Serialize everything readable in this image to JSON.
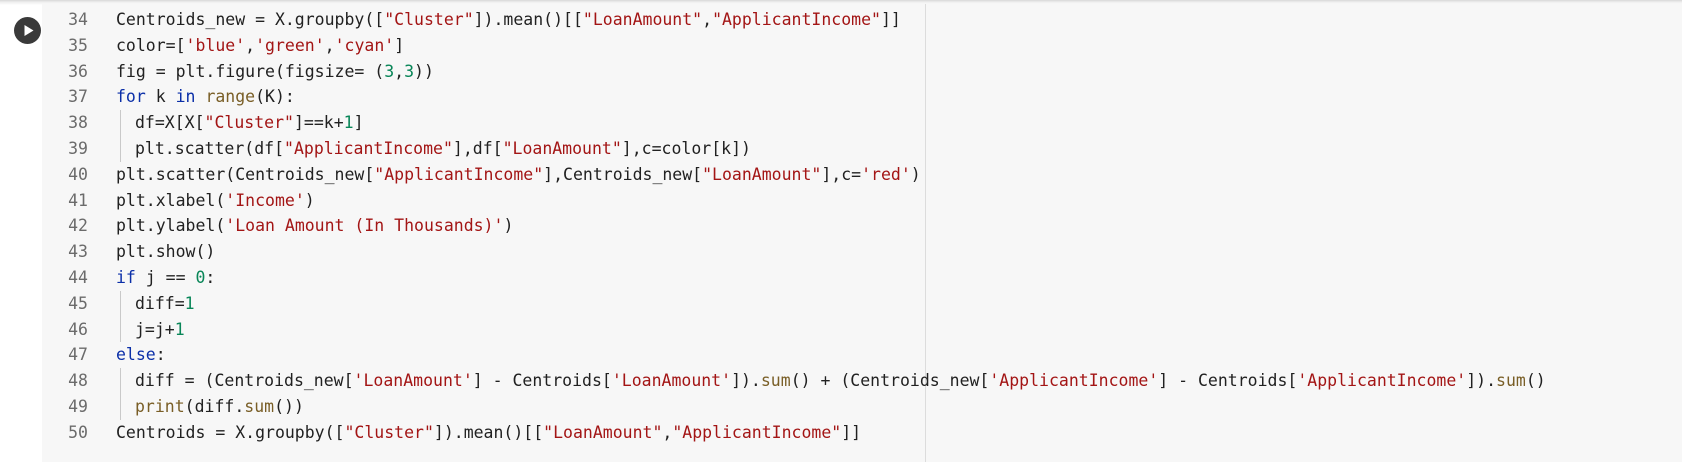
{
  "editor": {
    "lines": [
      {
        "number": "34",
        "indent": 0,
        "tokens": [
          {
            "t": "Centroids_new = X.groupby([",
            "c": "plain"
          },
          {
            "t": "\"Cluster\"",
            "c": "str"
          },
          {
            "t": "]).mean()[[",
            "c": "plain"
          },
          {
            "t": "\"LoanAmount\"",
            "c": "str"
          },
          {
            "t": ",",
            "c": "plain"
          },
          {
            "t": "\"ApplicantIncome\"",
            "c": "str"
          },
          {
            "t": "]]",
            "c": "plain"
          }
        ]
      },
      {
        "number": "35",
        "indent": 0,
        "tokens": [
          {
            "t": "color=[",
            "c": "plain"
          },
          {
            "t": "'blue'",
            "c": "str"
          },
          {
            "t": ",",
            "c": "plain"
          },
          {
            "t": "'green'",
            "c": "str"
          },
          {
            "t": ",",
            "c": "plain"
          },
          {
            "t": "'cyan'",
            "c": "str"
          },
          {
            "t": "]",
            "c": "plain"
          }
        ]
      },
      {
        "number": "36",
        "indent": 0,
        "tokens": [
          {
            "t": "fig = plt.figure(figsize= (",
            "c": "plain"
          },
          {
            "t": "3",
            "c": "num"
          },
          {
            "t": ",",
            "c": "plain"
          },
          {
            "t": "3",
            "c": "num"
          },
          {
            "t": "))",
            "c": "plain"
          }
        ]
      },
      {
        "number": "37",
        "indent": 0,
        "tokens": [
          {
            "t": "for",
            "c": "kw"
          },
          {
            "t": " k ",
            "c": "plain"
          },
          {
            "t": "in",
            "c": "kw"
          },
          {
            "t": " ",
            "c": "plain"
          },
          {
            "t": "range",
            "c": "fn"
          },
          {
            "t": "(K):",
            "c": "plain"
          }
        ]
      },
      {
        "number": "38",
        "indent": 1,
        "tokens": [
          {
            "t": "df=X[X[",
            "c": "plain"
          },
          {
            "t": "\"Cluster\"",
            "c": "str"
          },
          {
            "t": "]==k+",
            "c": "plain"
          },
          {
            "t": "1",
            "c": "num"
          },
          {
            "t": "]",
            "c": "plain"
          }
        ]
      },
      {
        "number": "39",
        "indent": 1,
        "tokens": [
          {
            "t": "plt.scatter(df[",
            "c": "plain"
          },
          {
            "t": "\"ApplicantIncome\"",
            "c": "str"
          },
          {
            "t": "],df[",
            "c": "plain"
          },
          {
            "t": "\"LoanAmount\"",
            "c": "str"
          },
          {
            "t": "],c=color[k])",
            "c": "plain"
          }
        ]
      },
      {
        "number": "40",
        "indent": 0,
        "tokens": [
          {
            "t": "plt.scatter(Centroids_new[",
            "c": "plain"
          },
          {
            "t": "\"ApplicantIncome\"",
            "c": "str"
          },
          {
            "t": "],Centroids_new[",
            "c": "plain"
          },
          {
            "t": "\"LoanAmount\"",
            "c": "str"
          },
          {
            "t": "],c=",
            "c": "plain"
          },
          {
            "t": "'red'",
            "c": "str"
          },
          {
            "t": ")",
            "c": "plain"
          }
        ]
      },
      {
        "number": "41",
        "indent": 0,
        "tokens": [
          {
            "t": "plt.xlabel(",
            "c": "plain"
          },
          {
            "t": "'Income'",
            "c": "str"
          },
          {
            "t": ")",
            "c": "plain"
          }
        ]
      },
      {
        "number": "42",
        "indent": 0,
        "tokens": [
          {
            "t": "plt.ylabel(",
            "c": "plain"
          },
          {
            "t": "'Loan Amount (In Thousands)'",
            "c": "str"
          },
          {
            "t": ")",
            "c": "plain"
          }
        ]
      },
      {
        "number": "43",
        "indent": 0,
        "tokens": [
          {
            "t": "plt.show()",
            "c": "plain"
          }
        ]
      },
      {
        "number": "44",
        "indent": 0,
        "tokens": [
          {
            "t": "if",
            "c": "kw"
          },
          {
            "t": " j == ",
            "c": "plain"
          },
          {
            "t": "0",
            "c": "num"
          },
          {
            "t": ":",
            "c": "plain"
          }
        ]
      },
      {
        "number": "45",
        "indent": 1,
        "tokens": [
          {
            "t": "diff=",
            "c": "plain"
          },
          {
            "t": "1",
            "c": "num"
          }
        ]
      },
      {
        "number": "46",
        "indent": 1,
        "tokens": [
          {
            "t": "j=j+",
            "c": "plain"
          },
          {
            "t": "1",
            "c": "num"
          }
        ]
      },
      {
        "number": "47",
        "indent": 0,
        "tokens": [
          {
            "t": "else",
            "c": "kw"
          },
          {
            "t": ":",
            "c": "plain"
          }
        ]
      },
      {
        "number": "48",
        "indent": 1,
        "tokens": [
          {
            "t": "diff = (Centroids_new[",
            "c": "plain"
          },
          {
            "t": "'LoanAmount'",
            "c": "str"
          },
          {
            "t": "] - Centroids[",
            "c": "plain"
          },
          {
            "t": "'LoanAmount'",
            "c": "str"
          },
          {
            "t": "]).",
            "c": "plain"
          },
          {
            "t": "sum",
            "c": "fn"
          },
          {
            "t": "() + (Centroids_new[",
            "c": "plain"
          },
          {
            "t": "'ApplicantIncome'",
            "c": "str"
          },
          {
            "t": "] - Centroids[",
            "c": "plain"
          },
          {
            "t": "'ApplicantIncome'",
            "c": "str"
          },
          {
            "t": "]).",
            "c": "plain"
          },
          {
            "t": "sum",
            "c": "fn"
          },
          {
            "t": "()",
            "c": "plain"
          }
        ]
      },
      {
        "number": "49",
        "indent": 1,
        "tokens": [
          {
            "t": "print",
            "c": "fn"
          },
          {
            "t": "(diff.",
            "c": "plain"
          },
          {
            "t": "sum",
            "c": "fn"
          },
          {
            "t": "())",
            "c": "plain"
          }
        ]
      },
      {
        "number": "50",
        "indent": 0,
        "tokens": [
          {
            "t": "Centroids = X.groupby([",
            "c": "plain"
          },
          {
            "t": "\"Cluster\"",
            "c": "str"
          },
          {
            "t": "]).mean()[[",
            "c": "plain"
          },
          {
            "t": "\"LoanAmount\"",
            "c": "str"
          },
          {
            "t": ",",
            "c": "plain"
          },
          {
            "t": "\"ApplicantIncome\"",
            "c": "str"
          },
          {
            "t": "]]",
            "c": "plain"
          }
        ]
      }
    ]
  },
  "icons": {
    "run": "play-icon"
  },
  "colors": {
    "keyword": "#0b2fa8",
    "string": "#a31515",
    "number": "#098658",
    "function": "#795e26",
    "plain": "#212121",
    "line_number": "#6b6b6b",
    "editor_background": "#f7f7f7",
    "run_button": "#3a3a3a"
  }
}
